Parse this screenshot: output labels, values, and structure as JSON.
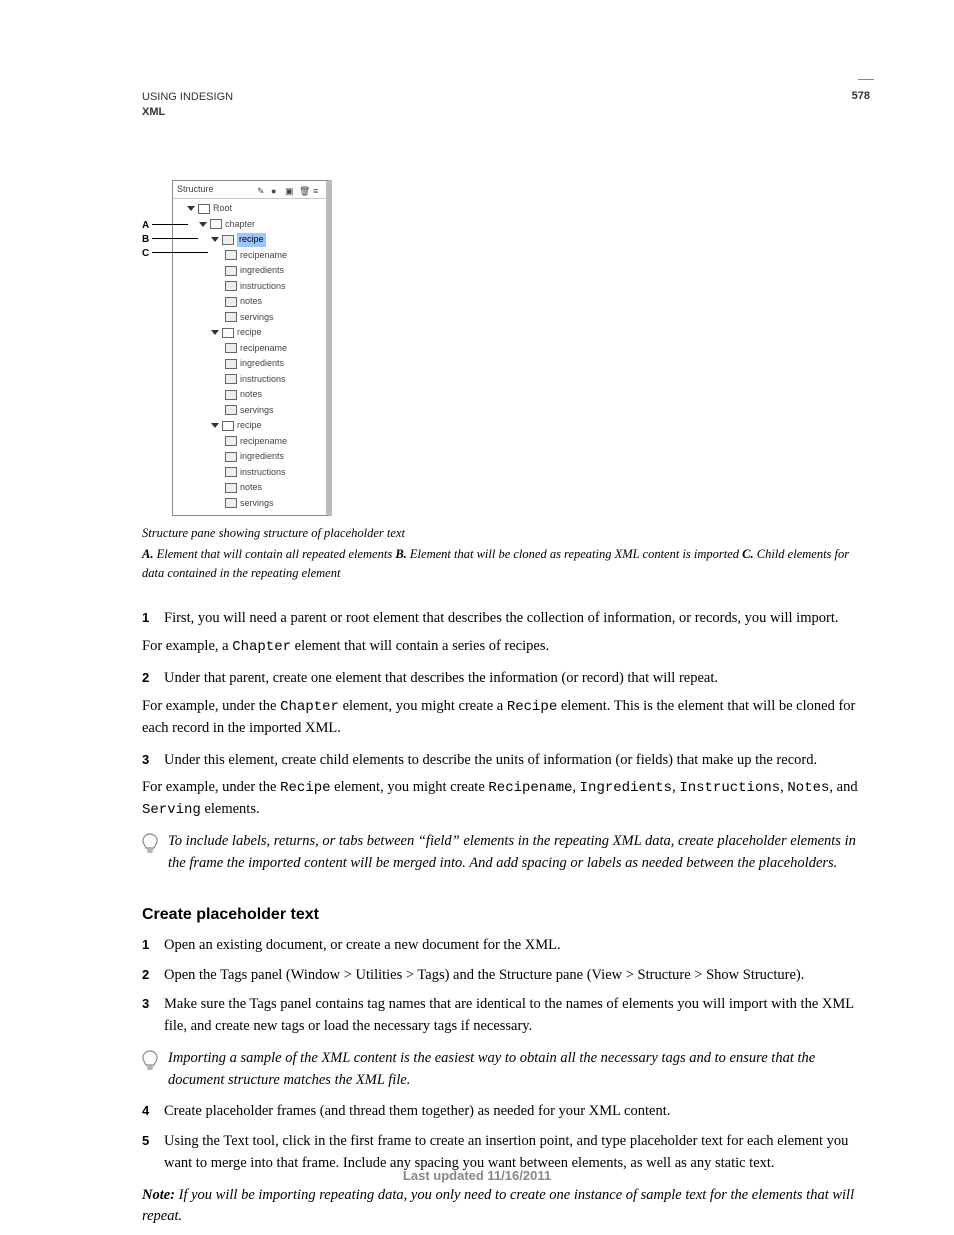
{
  "header": {
    "title": "USING INDESIGN",
    "section": "XML",
    "page_number": "578"
  },
  "figure": {
    "panel_title": "Structure",
    "toolbar_icons": [
      "pencil-icon",
      "dot-icon",
      "snippet-icon",
      "trash-icon",
      "menu-icon"
    ],
    "tree": {
      "root": "Root",
      "chapter": "chapter",
      "recipes": [
        {
          "name": "recipe",
          "children": [
            "recipename",
            "ingredients",
            "instructions",
            "notes",
            "servings"
          ]
        },
        {
          "name": "recipe",
          "children": [
            "recipename",
            "ingredients",
            "instructions",
            "notes",
            "servings"
          ]
        },
        {
          "name": "recipe",
          "children": [
            "recipename",
            "ingredients",
            "instructions",
            "notes",
            "servings"
          ]
        }
      ]
    },
    "callouts": {
      "A": "A",
      "B": "B",
      "C": "C"
    },
    "caption": "Structure pane showing structure of placeholder text",
    "legend_a_label": "A.",
    "legend_a_text": " Element that will contain all repeated elements  ",
    "legend_b_label": "B.",
    "legend_b_text": " Element that will be cloned as repeating XML content is imported  ",
    "legend_c_label": "C.",
    "legend_c_text": " Child elements for data contained in the repeating element"
  },
  "steps_a": {
    "s1_num": "1",
    "s1": "First, you will need a parent or root element that describes the collection of information, or records, you will import.",
    "p1a": "For example, a ",
    "p1_code": "Chapter",
    "p1b": " element that will contain a series of recipes.",
    "s2_num": "2",
    "s2": "Under that parent, create one element that describes the information (or record) that will repeat.",
    "p2a": "For example, under the ",
    "p2_code1": "Chapter",
    "p2b": " element, you might create a ",
    "p2_code2": "Recipe",
    "p2c": " element. This is the element that will be cloned for each record in the imported XML.",
    "s3_num": "3",
    "s3": "Under this element, create child elements to describe the units of information (or fields) that make up the record.",
    "p3a": "For example, under the ",
    "p3_code1": "Recipe",
    "p3b": " element, you might create ",
    "p3_code2": "Recipename",
    "p3c": ", ",
    "p3_code3": "Ingredients",
    "p3d": ", ",
    "p3_code4": "Instructions",
    "p3e": ", ",
    "p3_code5": "Notes",
    "p3f": ", and ",
    "p3_code6": "Serving",
    "p3g": " elements."
  },
  "tip1": "To include labels, returns, or tabs between “field” elements in the repeating XML data, create placeholder elements in the frame the imported content will be merged into. And add spacing or labels as needed between the placeholders.",
  "heading2": "Create placeholder text",
  "steps_b": {
    "s1_num": "1",
    "s1": "Open an existing document, or create a new document for the XML.",
    "s2_num": "2",
    "s2": "Open the Tags panel (Window > Utilities > Tags) and the Structure pane (View > Structure > Show Structure).",
    "s3_num": "3",
    "s3": "Make sure the Tags panel contains tag names that are identical to the names of elements you will import with the XML file, and create new tags or load the necessary tags if necessary."
  },
  "tip2": "Importing a sample of the XML content is the easiest way to obtain all the necessary tags and to ensure that the document structure matches the XML file.",
  "steps_c": {
    "s4_num": "4",
    "s4": "Create placeholder frames (and thread them together) as needed for your XML content.",
    "s5_num": "5",
    "s5": "Using the Text tool, click in the first frame to create an insertion point, and type placeholder text for each element you want to merge into that frame. Include any spacing you want between elements, as well as any static text."
  },
  "note_label": "Note:",
  "note_text": " If you will be importing repeating data, you only need to create one instance of sample text for the elements that will repeat.",
  "footer": "Last updated 11/16/2011"
}
